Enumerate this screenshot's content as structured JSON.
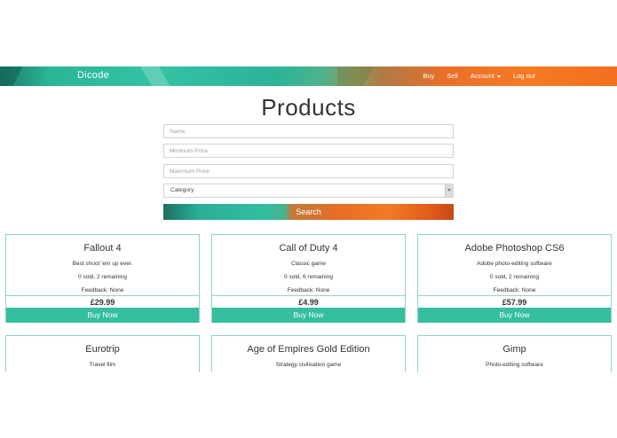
{
  "navbar": {
    "brand": "Dicode",
    "links": {
      "buy": "Buy",
      "sell": "Sell",
      "account": "Account",
      "logout": "Log out"
    },
    "accent_colors": [
      "#2ab597",
      "#35c2a3",
      "#f57a24"
    ]
  },
  "page": {
    "title": "Products"
  },
  "search_form": {
    "name_placeholder": "Name",
    "min_price_placeholder": "Minimum Price",
    "max_price_placeholder": "Maximum Price",
    "category_selected": "Category",
    "search_label": "Search"
  },
  "products": [
    {
      "name": "Fallout 4",
      "description": "Best shoot 'em up ever.",
      "stock": "0 sold, 2 remaining",
      "feedback": "Feedback: None",
      "price": "£29.99",
      "buy_label": "Buy Now"
    },
    {
      "name": "Call of Duty 4",
      "description": "Classic game",
      "stock": "0 sold, 6 remaining",
      "feedback": "Feedback: None",
      "price": "£4.99",
      "buy_label": "Buy Now"
    },
    {
      "name": "Adobe Photoshop CS6",
      "description": "Adobe photo-editing software",
      "stock": "0 sold, 2 remaining",
      "feedback": "Feedback: None",
      "price": "£57.99",
      "buy_label": "Buy Now"
    },
    {
      "name": "Eurotrip",
      "description": "Travel film"
    },
    {
      "name": "Age of Empires Gold Edition",
      "description": "Strategy civilisation game"
    },
    {
      "name": "Gimp",
      "description": "Photo-editing software"
    }
  ],
  "colors": {
    "card_border": "#8ed5c6",
    "buy_button": "#35be9f"
  }
}
